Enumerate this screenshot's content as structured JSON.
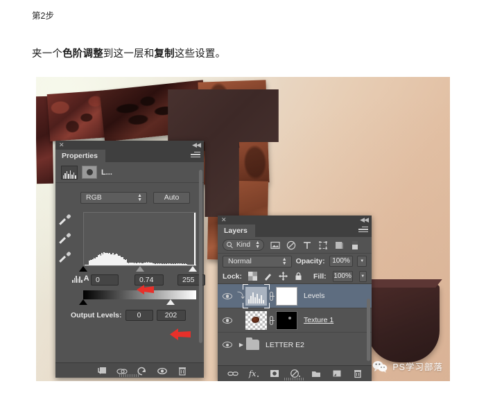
{
  "article": {
    "step_label": "第2步",
    "description_plain": "夹一个色阶调整到这一层和复制这些设置。",
    "desc_part1": "夹一个",
    "desc_bold1": "色阶调整",
    "desc_part2": "到这一层和",
    "desc_bold2": "复制",
    "desc_part3": "这些设置。"
  },
  "properties_panel": {
    "tab_label": "Properties",
    "close_icon": "close-icon",
    "collapse_icon": "collapse-icon",
    "menu_icon": "panel-menu-icon",
    "adjustment_title": "L...",
    "channel_select": "RGB",
    "auto_button": "Auto",
    "eyedroppers": [
      "set-black-point-eyedropper",
      "set-gray-point-eyedropper",
      "set-white-point-eyedropper"
    ],
    "input_levels": {
      "black": "0",
      "gamma": "0.74",
      "white": "255"
    },
    "output_levels": {
      "label": "Output Levels:",
      "black": "0",
      "white": "202"
    },
    "footer_icons": [
      "clip-to-layer-icon",
      "view-previous-state-icon",
      "reset-icon",
      "toggle-visibility-icon",
      "delete-adjustment-icon"
    ]
  },
  "layers_panel": {
    "tab_label": "Layers",
    "close_icon": "close-icon",
    "collapse_icon": "collapse-icon",
    "menu_icon": "panel-menu-icon",
    "filter": {
      "kind_label": "Kind",
      "icons": [
        "filter-pixel-icon",
        "filter-adjustment-icon",
        "filter-type-icon",
        "filter-shape-icon",
        "filter-smart-object-icon",
        "filter-toggle-icon"
      ]
    },
    "blend_mode": "Normal",
    "opacity_label": "Opacity:",
    "opacity_value": "100%",
    "lock_label": "Lock:",
    "lock_icons": [
      "lock-transparency-icon",
      "lock-image-icon",
      "lock-position-icon",
      "lock-all-icon"
    ],
    "fill_label": "Fill:",
    "fill_value": "100%",
    "layers": [
      {
        "name": "Levels",
        "type": "adjustment",
        "selected": true,
        "clipped": true,
        "visible": true,
        "underlined": false
      },
      {
        "name": "Texture 1",
        "type": "pixel",
        "selected": false,
        "clipped": false,
        "visible": true,
        "underlined": true
      },
      {
        "name": "LETTER E2",
        "type": "group",
        "selected": false,
        "clipped": false,
        "visible": true,
        "underlined": false
      }
    ],
    "footer_icons": [
      "link-layers-icon",
      "layer-style-fx-icon",
      "add-mask-icon",
      "new-adjustment-icon",
      "new-group-icon",
      "new-layer-icon",
      "delete-layer-icon"
    ]
  },
  "annotations": {
    "arrow_gamma": "red-arrow-gamma",
    "arrow_output": "red-arrow-output-levels"
  },
  "watermark": {
    "text": "PS学习部落",
    "icon": "wechat-icon"
  },
  "colors": {
    "panel_bg": "#535353",
    "panel_header": "#3f3f3f",
    "selected_layer": "#5e6d80",
    "annotation_red": "#e8302a",
    "canvas_light": "#eef0e2",
    "canvas_tan": "#dcb89c"
  }
}
